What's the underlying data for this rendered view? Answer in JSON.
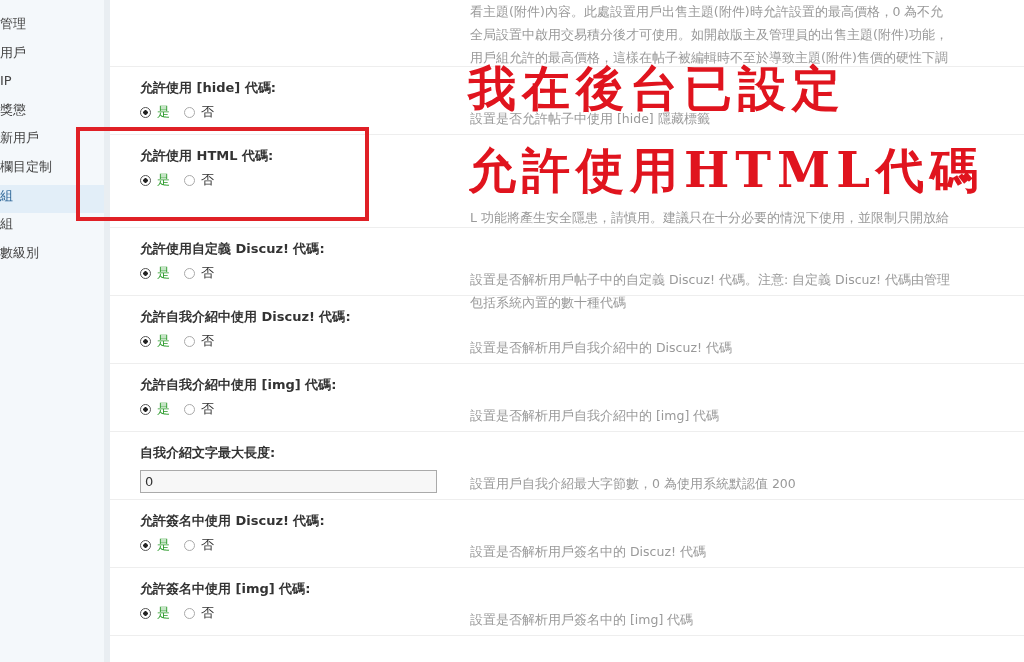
{
  "sidebar": {
    "items": [
      {
        "label": "管理",
        "selected": false
      },
      {
        "label": "用戶",
        "selected": false
      },
      {
        "label": "IP",
        "selected": false
      },
      {
        "label": "獎懲",
        "selected": false
      },
      {
        "label": "新用戶",
        "selected": false
      },
      {
        "label": "欄目定制",
        "selected": false
      },
      {
        "label": "組",
        "selected": true
      },
      {
        "label": "組",
        "selected": false
      },
      {
        "label": "數級別",
        "selected": false
      }
    ]
  },
  "top_description": [
    "看主題(附件)內容。此處設置用戶出售主題(附件)時允許設置的最高價格，0 為不允",
    "全局設置中啟用交易積分後才可使用。如開啟版主及管理員的出售主題(附件)功能，",
    "用戶組允許的最高價格，這樣在帖子被編輯時不至於導致主題(附件)售價的硬性下調"
  ],
  "settings": [
    {
      "kind": "radio",
      "label": "允許使用 [hide] 代碼:",
      "options": [
        {
          "label": "是",
          "selected": true
        },
        {
          "label": "否",
          "selected": false
        }
      ],
      "description": [
        "設置是否允許帖子中使用 [hide] 隱藏標籤"
      ]
    },
    {
      "kind": "radio",
      "label": "允許使用 HTML 代碼:",
      "highlighted": true,
      "options": [
        {
          "label": "是",
          "selected": true
        },
        {
          "label": "否",
          "selected": false
        }
      ],
      "description": [
        "L 功能將產生安全隱患，請慎用。建議只在十分必要的情況下使用，並限制只開放給"
      ]
    },
    {
      "kind": "radio",
      "label": "允許使用自定義 Discuz! 代碼:",
      "options": [
        {
          "label": "是",
          "selected": true
        },
        {
          "label": "否",
          "selected": false
        }
      ],
      "description": [
        "設置是否解析用戶帖子中的自定義 Discuz! 代碼。注意: 自定義 Discuz! 代碼由管理",
        "包括系統內置的數十種代碼"
      ]
    },
    {
      "kind": "radio",
      "label": "允許自我介紹中使用 Discuz! 代碼:",
      "options": [
        {
          "label": "是",
          "selected": true
        },
        {
          "label": "否",
          "selected": false
        }
      ],
      "description": [
        "設置是否解析用戶自我介紹中的 Discuz! 代碼"
      ]
    },
    {
      "kind": "radio",
      "label": "允許自我介紹中使用 [img] 代碼:",
      "options": [
        {
          "label": "是",
          "selected": true
        },
        {
          "label": "否",
          "selected": false
        }
      ],
      "description": [
        "設置是否解析用戶自我介紹中的 [img] 代碼"
      ]
    },
    {
      "kind": "text",
      "label": "自我介紹文字最大長度:",
      "value": "0",
      "description": [
        "設置用戶自我介紹最大字節數，0 為使用系統默認值 200"
      ]
    },
    {
      "kind": "radio",
      "label": "允許簽名中使用 Discuz! 代碼:",
      "options": [
        {
          "label": "是",
          "selected": true
        },
        {
          "label": "否",
          "selected": false
        }
      ],
      "description": [
        "設置是否解析用戶簽名中的 Discuz! 代碼"
      ]
    },
    {
      "kind": "radio",
      "label": "允許簽名中使用 [img] 代碼:",
      "options": [
        {
          "label": "是",
          "selected": true
        },
        {
          "label": "否",
          "selected": false
        }
      ],
      "description": [
        "設置是否解析用戶簽名中的 [img] 代碼"
      ]
    }
  ],
  "annotation": {
    "lines": [
      "我在後台已設定",
      "允許使用HTML代碼"
    ]
  }
}
